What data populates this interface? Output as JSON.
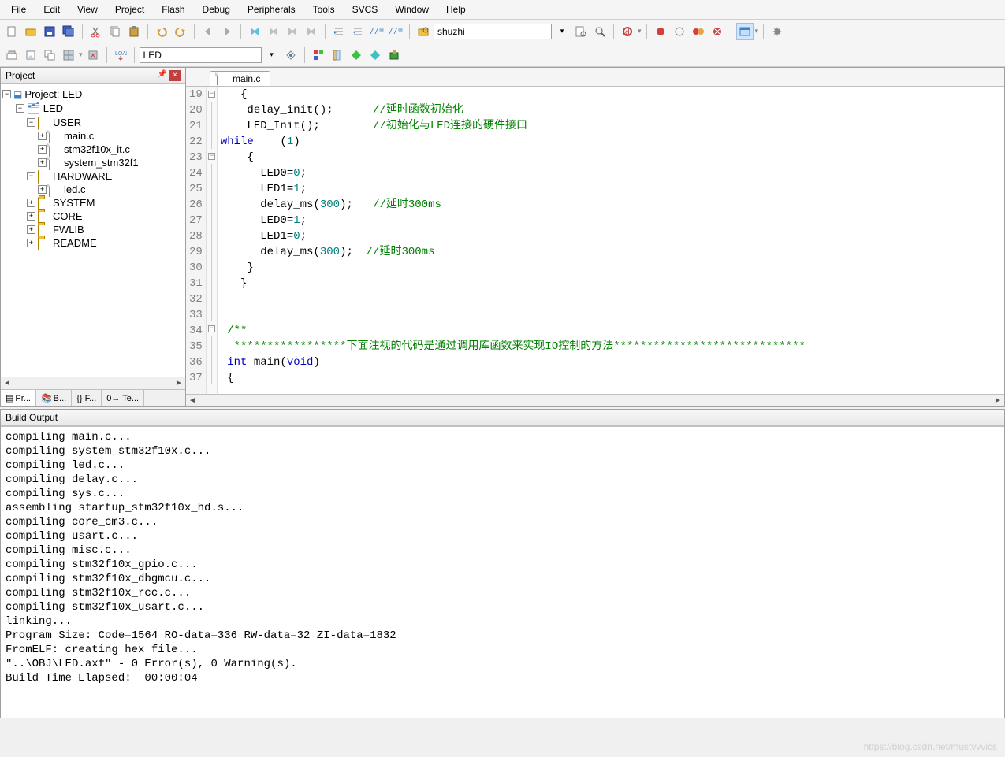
{
  "menu": [
    "File",
    "Edit",
    "View",
    "Project",
    "Flash",
    "Debug",
    "Peripherals",
    "Tools",
    "SVCS",
    "Window",
    "Help"
  ],
  "toolbar2_input": "shuzhi",
  "toolbar3_input": "LED",
  "project_panel": {
    "title": "Project",
    "root": "Project: LED",
    "target": "LED",
    "groups": [
      {
        "name": "USER",
        "open": true,
        "files": [
          "main.c",
          "stm32f10x_it.c",
          "system_stm32f1"
        ]
      },
      {
        "name": "HARDWARE",
        "open": true,
        "files": [
          "led.c"
        ]
      },
      {
        "name": "SYSTEM",
        "open": false,
        "files": []
      },
      {
        "name": "CORE",
        "open": false,
        "files": []
      },
      {
        "name": "FWLIB",
        "open": false,
        "files": []
      },
      {
        "name": "README",
        "open": false,
        "files": []
      }
    ],
    "tabs": [
      "Pr...",
      "B...",
      "{} F...",
      "0→ Te..."
    ]
  },
  "editor": {
    "tab": "main.c",
    "first_line": 19,
    "lines": [
      {
        "n": 19,
        "fold": "-",
        "t": "   {"
      },
      {
        "n": 20,
        "t": "    delay_init();      ",
        "c": "//延时函数初始化"
      },
      {
        "n": 21,
        "t": "    LED_Init();        ",
        "c": "//初始化与LED连接的硬件接口"
      },
      {
        "n": 22,
        "t": "    ",
        "k": "while",
        "t2": "(",
        "num": "1",
        "t3": ")"
      },
      {
        "n": 23,
        "fold": "-",
        "t": "    {"
      },
      {
        "n": 24,
        "t": "      LED0=",
        "num": "0",
        "t3": ";"
      },
      {
        "n": 25,
        "t": "      LED1=",
        "num": "1",
        "t3": ";"
      },
      {
        "n": 26,
        "t": "      delay_ms(",
        "num": "300",
        "t3": ");   ",
        "c": "//延时300ms"
      },
      {
        "n": 27,
        "t": "      LED0=",
        "num": "1",
        "t3": ";"
      },
      {
        "n": 28,
        "t": "      LED1=",
        "num": "0",
        "t3": ";"
      },
      {
        "n": 29,
        "t": "      delay_ms(",
        "num": "300",
        "t3": ");  ",
        "c": "//延时300ms"
      },
      {
        "n": 30,
        "t": "    }"
      },
      {
        "n": 31,
        "t": "   }"
      },
      {
        "n": 32,
        "t": ""
      },
      {
        "n": 33,
        "t": ""
      },
      {
        "n": 34,
        "fold": "-",
        "c": " /**"
      },
      {
        "n": 35,
        "c": "  *****************下面注视的代码是通过调用库函数来实现IO控制的方法*****************************"
      },
      {
        "n": 36,
        "k": " int",
        "t2": " main(",
        "k2": "void",
        "t3": ")"
      },
      {
        "n": 37,
        "t": " {"
      }
    ]
  },
  "build": {
    "title": "Build Output",
    "lines": [
      "compiling main.c...",
      "compiling system_stm32f10x.c...",
      "compiling led.c...",
      "compiling delay.c...",
      "compiling sys.c...",
      "assembling startup_stm32f10x_hd.s...",
      "compiling core_cm3.c...",
      "compiling usart.c...",
      "compiling misc.c...",
      "compiling stm32f10x_gpio.c...",
      "compiling stm32f10x_dbgmcu.c...",
      "compiling stm32f10x_rcc.c...",
      "compiling stm32f10x_usart.c...",
      "linking...",
      "Program Size: Code=1564 RO-data=336 RW-data=32 ZI-data=1832",
      "FromELF: creating hex file...",
      "\"..\\OBJ\\LED.axf\" - 0 Error(s), 0 Warning(s).",
      "Build Time Elapsed:  00:00:04"
    ]
  },
  "watermark": "https://blog.csdn.net/mustvvvics"
}
